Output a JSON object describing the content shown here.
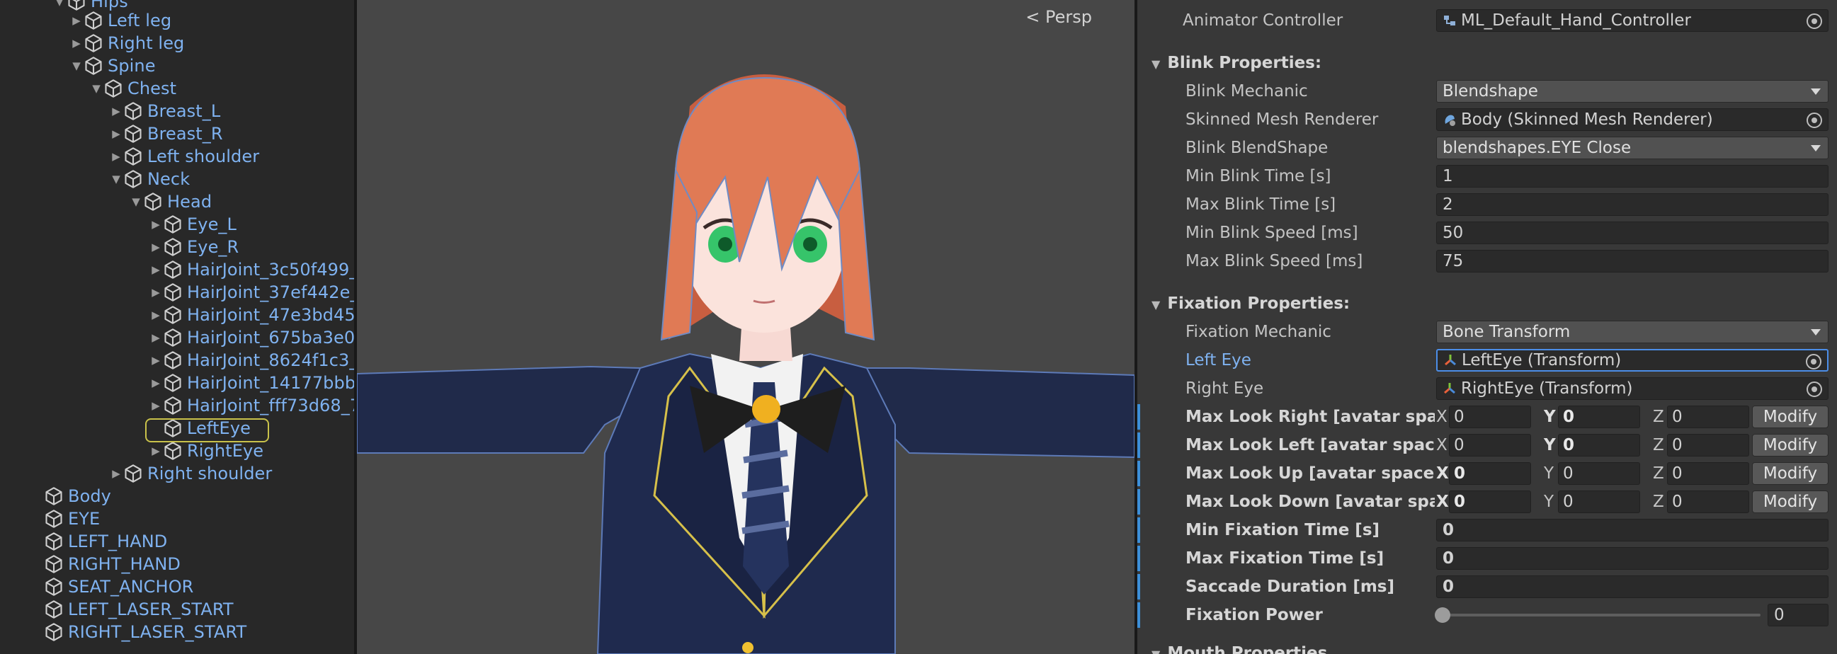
{
  "hierarchy": {
    "top_partial": "Hips",
    "items": [
      {
        "label": "Left leg",
        "fold": "▶"
      },
      {
        "label": "Right leg",
        "fold": "▶"
      },
      {
        "label": "Spine",
        "fold": "▼"
      },
      {
        "label": "Chest",
        "fold": "▼"
      },
      {
        "label": "Breast_L",
        "fold": "▶"
      },
      {
        "label": "Breast_R",
        "fold": "▶"
      },
      {
        "label": "Left shoulder",
        "fold": "▶"
      },
      {
        "label": "Neck",
        "fold": "▼"
      },
      {
        "label": "Head",
        "fold": "▼"
      },
      {
        "label": "Eye_L",
        "fold": "▶"
      },
      {
        "label": "Eye_R",
        "fold": "▶"
      },
      {
        "label": "HairJoint_3c50f499_",
        "fold": "▶"
      },
      {
        "label": "HairJoint_37ef442e_",
        "fold": "▶"
      },
      {
        "label": "HairJoint_47e3bd45",
        "fold": "▶"
      },
      {
        "label": "HairJoint_675ba3e0",
        "fold": "▶"
      },
      {
        "label": "HairJoint_8624f1c3_",
        "fold": "▶"
      },
      {
        "label": "HairJoint_14177bbb_",
        "fold": "▶"
      },
      {
        "label": "HairJoint_fff73d68_7",
        "fold": "▶"
      },
      {
        "label": "LeftEye",
        "fold": ""
      },
      {
        "label": "RightEye",
        "fold": "▶"
      },
      {
        "label": "Right shoulder",
        "fold": "▶"
      },
      {
        "label": "Body",
        "fold": ""
      },
      {
        "label": "EYE",
        "fold": ""
      },
      {
        "label": "LEFT_HAND",
        "fold": ""
      },
      {
        "label": "RIGHT_HAND",
        "fold": ""
      },
      {
        "label": "SEAT_ANCHOR",
        "fold": ""
      },
      {
        "label": "LEFT_LASER_START",
        "fold": ""
      },
      {
        "label": "RIGHT_LASER_START",
        "fold": ""
      }
    ],
    "selected": "LeftEye"
  },
  "scene": {
    "persp_label": "Persp",
    "colors": {
      "background": "#474747",
      "hair": "#e07a55",
      "jacket": "#1f2a4e",
      "eye": "#36c46a"
    }
  },
  "inspector": {
    "animator_controller": {
      "label": "Animator Controller",
      "value": "ML_Default_Hand_Controller"
    },
    "blink": {
      "header": "Blink Properties:",
      "mechanic": {
        "label": "Blink Mechanic",
        "value": "Blendshape"
      },
      "renderer": {
        "label": "Skinned Mesh Renderer",
        "value": "Body (Skinned Mesh Renderer)"
      },
      "blendshape": {
        "label": "Blink BlendShape",
        "value": "blendshapes.EYE Close"
      },
      "min_time": {
        "label": "Min Blink Time [s]",
        "value": "1"
      },
      "max_time": {
        "label": "Max Blink Time [s]",
        "value": "2"
      },
      "min_speed": {
        "label": "Min Blink Speed [ms]",
        "value": "50"
      },
      "max_speed": {
        "label": "Max Blink Speed [ms]",
        "value": "75"
      }
    },
    "fixation": {
      "header": "Fixation Properties:",
      "mechanic": {
        "label": "Fixation Mechanic",
        "value": "Bone Transform"
      },
      "left_eye": {
        "label": "Left Eye",
        "value": "LeftEye (Transform)"
      },
      "right_eye": {
        "label": "Right Eye",
        "value": "RightEye (Transform)"
      },
      "look_right": {
        "label": "Max Look Right [avatar space]",
        "x": "0",
        "y": "0",
        "z": "0"
      },
      "look_left": {
        "label": "Max Look Left [avatar space]",
        "x": "0",
        "y": "0",
        "z": "0"
      },
      "look_up": {
        "label": "Max Look Up [avatar space]",
        "x": "0",
        "y": "0",
        "z": "0"
      },
      "look_down": {
        "label": "Max Look Down [avatar space]",
        "x": "0",
        "y": "0",
        "z": "0"
      },
      "modify_label": "Modify",
      "axis_x": "X",
      "axis_y": "Y",
      "axis_z": "Z",
      "min_fix_time": {
        "label": "Min Fixation Time [s]",
        "value": "0"
      },
      "max_fix_time": {
        "label": "Max Fixation Time [s]",
        "value": "0"
      },
      "saccade": {
        "label": "Saccade Duration [ms]",
        "value": "0"
      },
      "power": {
        "label": "Fixation Power",
        "value": "0",
        "fraction": 0
      }
    },
    "next_header_partial": "Mouth Properties"
  }
}
